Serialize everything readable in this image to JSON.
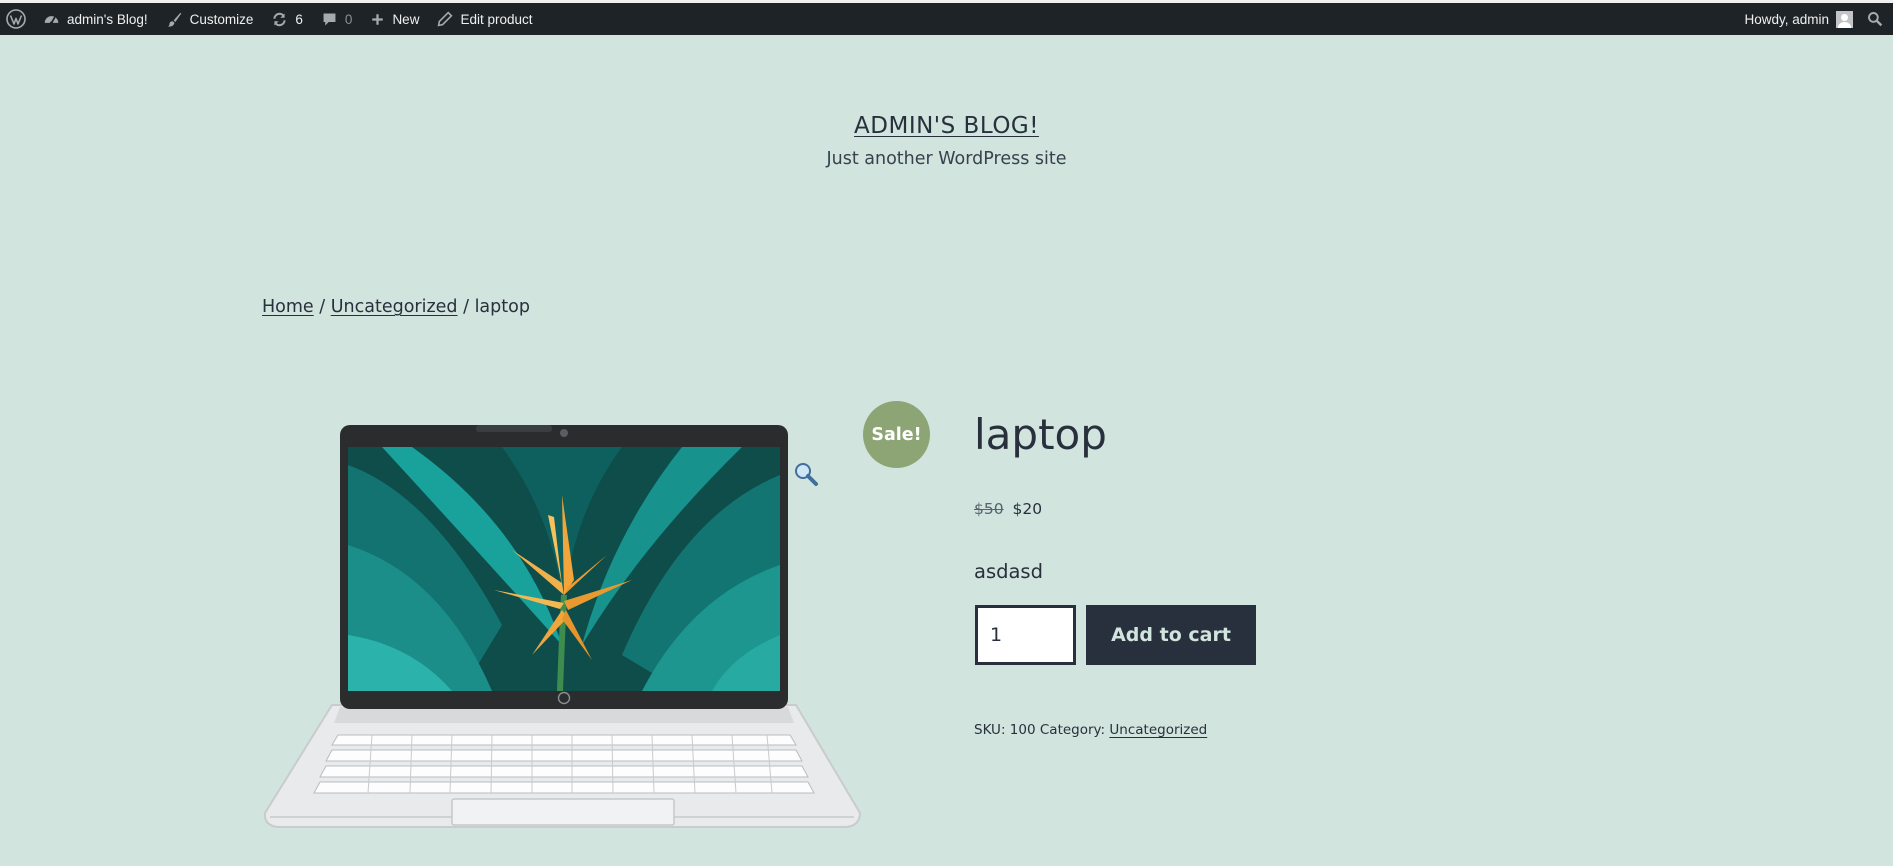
{
  "adminbar": {
    "wp_logo": "wordpress-icon",
    "site_name": "admin's Blog!",
    "customize": "Customize",
    "updates_count": "6",
    "comments_count": "0",
    "new": "New",
    "edit_product": "Edit product",
    "howdy": "Howdy, admin"
  },
  "header": {
    "site_title": "ADMIN'S BLOG!",
    "tagline": "Just another WordPress site"
  },
  "breadcrumb": {
    "home": "Home",
    "sep1": " / ",
    "category": "Uncategorized",
    "sep2": " / ",
    "current": "laptop"
  },
  "product": {
    "sale_badge": "Sale!",
    "title": "laptop",
    "regular_price": "$50",
    "sale_price": "$20",
    "short_description": "asdasd",
    "quantity": "1",
    "add_to_cart_label": "Add to cart",
    "sku_label": "SKU:",
    "sku": "100",
    "category_label": "Category:",
    "category": "Uncategorized"
  },
  "colors": {
    "background": "#d1e4dd",
    "text": "#28303d",
    "adminbar": "#1d2327",
    "sale_badge": "#8da574",
    "button": "#28303d"
  }
}
